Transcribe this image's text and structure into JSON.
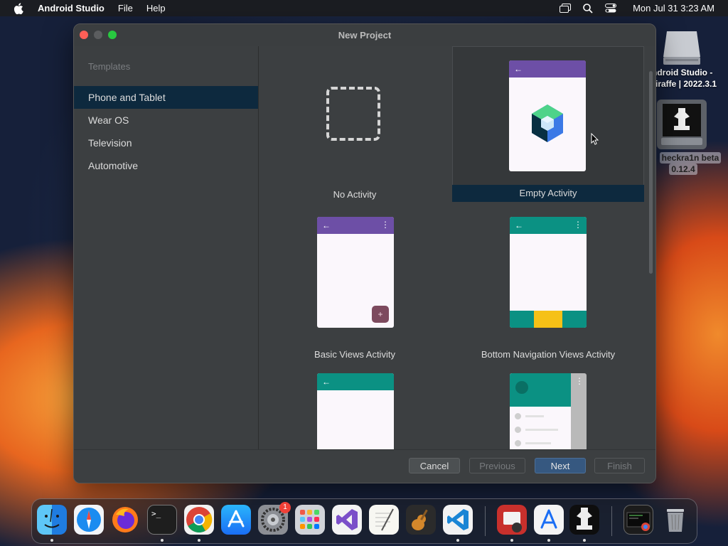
{
  "menubar": {
    "app_name": "Android Studio",
    "menus": [
      "File",
      "Help"
    ],
    "clock": "Mon Jul 31  3:23 AM"
  },
  "desktop": {
    "icons": [
      {
        "label_line1": "ndroid Studio -",
        "label_line2": "iraffe | 2022.3.1"
      },
      {
        "label_line1": "heckra1n beta",
        "label_line2": "0.12.4"
      }
    ]
  },
  "window": {
    "title": "New Project",
    "sidebar": {
      "header": "Templates",
      "items": [
        {
          "label": "Phone and Tablet",
          "selected": true
        },
        {
          "label": "Wear OS",
          "selected": false
        },
        {
          "label": "Television",
          "selected": false
        },
        {
          "label": "Automotive",
          "selected": false
        }
      ]
    },
    "templates": [
      {
        "name": "No Activity",
        "selected": false
      },
      {
        "name": "Empty Activity",
        "selected": true
      },
      {
        "name": "Basic Views Activity",
        "selected": false
      },
      {
        "name": "Bottom Navigation Views Activity",
        "selected": false
      },
      {
        "name": "",
        "selected": false
      },
      {
        "name": "",
        "selected": false
      }
    ],
    "buttons": {
      "cancel": "Cancel",
      "previous": "Previous",
      "next": "Next",
      "finish": "Finish"
    }
  },
  "dock": {
    "apps": [
      "finder-icon",
      "safari-icon",
      "firefox-icon",
      "terminal-icon",
      "chrome-icon",
      "app-store-icon",
      "system-settings-icon",
      "launchpad-icon",
      "visual-studio-icon",
      "textedit-icon",
      "garageband-icon",
      "vscode-icon",
      "photo-booth-icon",
      "xcode-icon",
      "checkra1n-icon",
      "screen-recording-icon",
      "trash-icon"
    ],
    "settings_badge": "1"
  },
  "colors": {
    "accent": "#365880",
    "selection": "#0d293e",
    "toolbar_purple": "#6d4fa6",
    "toolbar_teal": "#0b9183"
  }
}
